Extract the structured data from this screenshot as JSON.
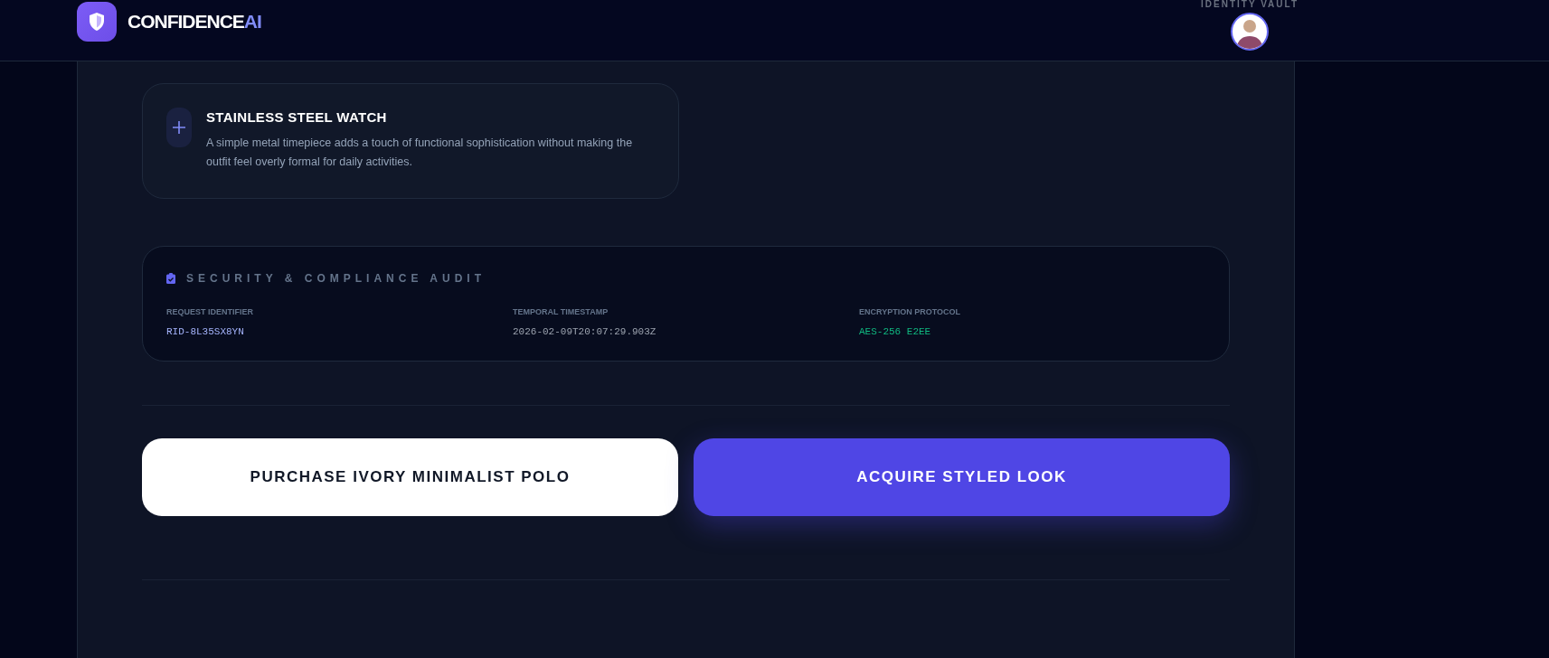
{
  "header": {
    "brand": {
      "name": "CONFIDENCE",
      "accent": "AI"
    },
    "vault_label": "IDENTITY VAULT"
  },
  "items": [
    {
      "title": "STAINLESS STEEL WATCH",
      "description": "A simple metal timepiece adds a touch of functional sophistication without making the outfit feel overly formal for daily activities."
    }
  ],
  "audit": {
    "title": "SECURITY & COMPLIANCE AUDIT",
    "fields": [
      {
        "label": "REQUEST IDENTIFIER",
        "value": "RID-8L35SX8YN",
        "color": "#a5b4fc"
      },
      {
        "label": "TEMPORAL TIMESTAMP",
        "value": "2026-02-09T20:07:29.903Z",
        "color": "#9ca3af"
      },
      {
        "label": "ENCRYPTION PROTOCOL",
        "value": "AES-256 E2EE",
        "color": "#10b981"
      }
    ]
  },
  "actions": [
    {
      "label": "PURCHASE IVORY MINIMALIST POLO",
      "kind": "secondary"
    },
    {
      "label": "ACQUIRE STYLED LOOK",
      "kind": "primary"
    }
  ]
}
